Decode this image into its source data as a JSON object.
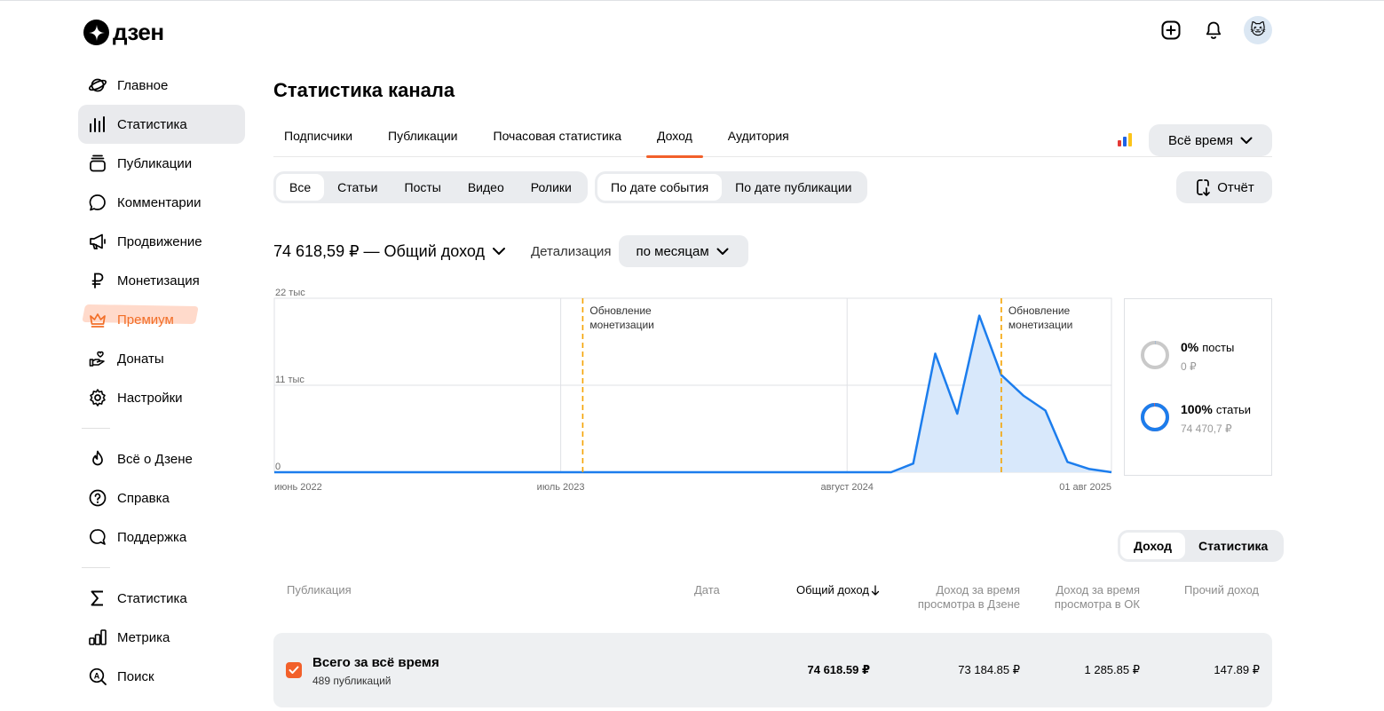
{
  "logo": {
    "text": "дзен"
  },
  "header": {
    "add_icon": "plus-square-icon",
    "bell_icon": "bell-icon",
    "avatar_icon": "cat-avatar",
    "avatar_glyph": "🐱"
  },
  "sidebar": {
    "items": [
      {
        "label": "Главное",
        "icon": "planet-icon"
      },
      {
        "label": "Статистика",
        "icon": "bars-icon",
        "active": true
      },
      {
        "label": "Публикации",
        "icon": "stack-icon"
      },
      {
        "label": "Комментарии",
        "icon": "comment-icon"
      },
      {
        "label": "Продвижение",
        "icon": "megaphone-icon"
      },
      {
        "label": "Монетизация",
        "icon": "ruble-icon"
      },
      {
        "label": "Премиум",
        "icon": "crown-icon"
      },
      {
        "label": "Донаты",
        "icon": "donate-icon"
      },
      {
        "label": "Настройки",
        "icon": "gear-icon"
      }
    ],
    "items2": [
      {
        "label": "Всё о Дзене",
        "icon": "flame-icon"
      },
      {
        "label": "Справка",
        "icon": "help-icon"
      },
      {
        "label": "Поддержка",
        "icon": "support-icon"
      }
    ],
    "items3": [
      {
        "label": "Статистика",
        "icon": "sigma-icon"
      },
      {
        "label": "Метрика",
        "icon": "metrika-icon"
      },
      {
        "label": "Поиск",
        "icon": "search-icon"
      }
    ]
  },
  "page": {
    "title": "Статистика канала"
  },
  "tabs": [
    "Подписчики",
    "Публикации",
    "Почасовая статистика",
    "Доход",
    "Аудитория"
  ],
  "active_tab": "Доход",
  "period": {
    "label": "Всё время"
  },
  "content_filter": {
    "items": [
      "Все",
      "Статьи",
      "Посты",
      "Видео",
      "Ролики"
    ],
    "selected": "Все"
  },
  "date_filter": {
    "items": [
      "По дате события",
      "По дате публикации"
    ],
    "selected": "По дате события"
  },
  "report": {
    "label": "Отчёт"
  },
  "summary": {
    "total": "74 618,59 ₽ — Общий доход",
    "detail_label": "Детализация",
    "detail_value": "по месяцам"
  },
  "chart_data": {
    "type": "area",
    "y_ticks": [
      "22 тыс",
      "11 тыс",
      "0"
    ],
    "x_ticks": [
      "июнь 2022",
      "июль 2023",
      "август 2024",
      "01 авг 2025"
    ],
    "ylim": [
      0,
      22000
    ],
    "annotations": [
      {
        "text": [
          "Обновление",
          "монетизации"
        ],
        "x": "2023-08"
      },
      {
        "text": [
          "Обновление",
          "монетизации"
        ],
        "x": "2025-03"
      }
    ],
    "x": [
      "2022-06",
      "2022-07",
      "2022-08",
      "2022-09",
      "2022-10",
      "2022-11",
      "2022-12",
      "2023-01",
      "2023-02",
      "2023-03",
      "2023-04",
      "2023-05",
      "2023-06",
      "2023-07",
      "2023-08",
      "2023-09",
      "2023-10",
      "2023-11",
      "2023-12",
      "2024-01",
      "2024-02",
      "2024-03",
      "2024-04",
      "2024-05",
      "2024-06",
      "2024-07",
      "2024-08",
      "2024-09",
      "2024-10",
      "2024-11",
      "2024-12",
      "2025-01",
      "2025-02",
      "2025-03",
      "2025-04",
      "2025-05",
      "2025-06",
      "2025-07",
      "2025-08"
    ],
    "series": [
      {
        "values": [
          0,
          0,
          0,
          0,
          0,
          0,
          0,
          0,
          0,
          0,
          0,
          0,
          0,
          0,
          0,
          0,
          0,
          0,
          0,
          0,
          0,
          0,
          0,
          0,
          0,
          0,
          0,
          0,
          0,
          1100,
          15000,
          7400,
          19800,
          12300,
          9700,
          7800,
          1300,
          400,
          0
        ]
      }
    ],
    "color": "#1c7ded",
    "fill": "#d8e8fb"
  },
  "breakdown": [
    {
      "pct": "0%",
      "name": "посты",
      "amount": "0 ₽",
      "fraction": 0.002
    },
    {
      "pct": "100%",
      "name": "статьи",
      "amount": "74 470,7 ₽",
      "fraction": 0.99
    }
  ],
  "table_toggle": {
    "items": [
      "Доход",
      "Статистика"
    ],
    "selected": "Доход"
  },
  "table": {
    "headers": {
      "publication": "Публикация",
      "date": "Дата",
      "total": "Общий доход",
      "zen_view_1": "Доход за время",
      "zen_view_2": "просмотра в Дзене",
      "ok_view_1": "Доход за время",
      "ok_view_2": "просмотра в ОК",
      "other": "Прочий доход"
    },
    "total_row": {
      "title": "Всего за всё время",
      "sub": "489 публикаций",
      "total": "74 618.59 ₽",
      "zen": "73 184.85 ₽",
      "ok": "1 285.85 ₽",
      "other": "147.89 ₽"
    }
  }
}
